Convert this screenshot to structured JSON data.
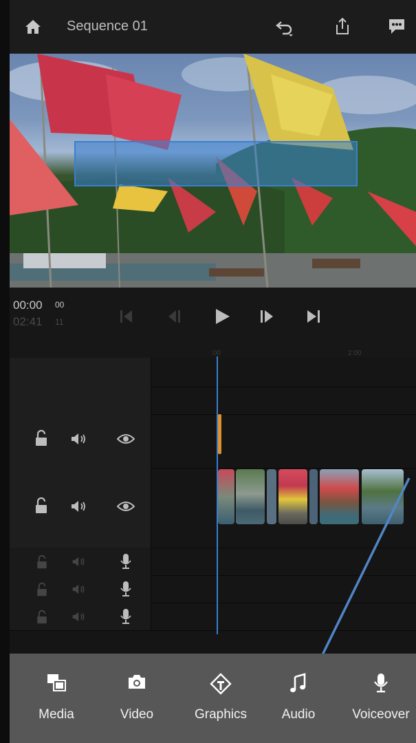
{
  "header": {
    "title": "Sequence 01"
  },
  "transport": {
    "current_time": "00:00",
    "current_frames": "00",
    "duration_time": "02:41",
    "duration_frames": "11"
  },
  "ruler": {
    "marks": [
      ":00",
      "2:00"
    ]
  },
  "toolbar": {
    "items": [
      {
        "label": "Media",
        "icon": "media-icon"
      },
      {
        "label": "Video",
        "icon": "camera-icon"
      },
      {
        "label": "Graphics",
        "icon": "graphics-icon"
      },
      {
        "label": "Audio",
        "icon": "music-note-icon"
      },
      {
        "label": "Voiceover",
        "icon": "microphone-icon"
      }
    ]
  },
  "colors": {
    "accent_blue": "#3a7fd0",
    "arrow_blue": "#4f86c6",
    "clip_marker": "#e0902a",
    "bottom_bar": "#575757"
  }
}
